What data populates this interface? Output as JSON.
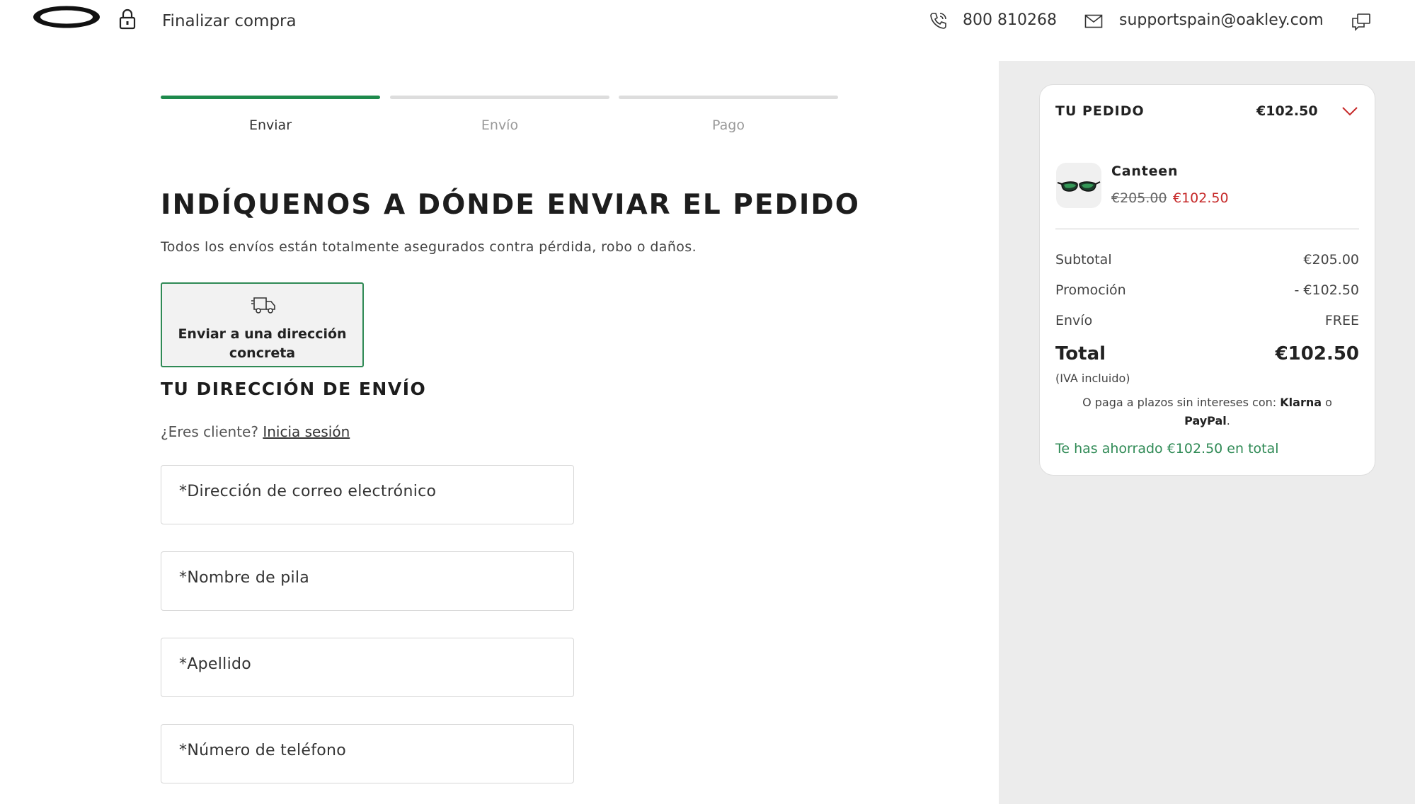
{
  "header": {
    "checkout_title": "Finalizar compra",
    "phone": "800 810268",
    "email": "supportspain@oakley.com"
  },
  "steps": [
    {
      "label": "Enviar",
      "active": true
    },
    {
      "label": "Envío",
      "active": false
    },
    {
      "label": "Pago",
      "active": false
    }
  ],
  "main": {
    "title": "INDÍQUENOS A DÓNDE ENVIAR EL PEDIDO",
    "subtitle": "Todos los envíos están totalmente asegurados contra pérdida, robo o daños.",
    "ship_option_label": "Enviar a una dirección concreta",
    "address_heading": "TU DIRECCIÓN DE ENVÍO",
    "login_prompt": "¿Eres cliente?",
    "login_link": "Inicia sesión",
    "fields": [
      {
        "label": "Dirección de correo electrónico"
      },
      {
        "label": "Nombre de pila"
      },
      {
        "label": "Apellido"
      },
      {
        "label": "Número de teléfono"
      }
    ]
  },
  "order": {
    "label": "TU PEDIDO",
    "total_header": "€102.50",
    "product": {
      "name": "Canteen",
      "old_price": "€205.00",
      "new_price": "€102.50"
    },
    "rows": [
      {
        "label": "Subtotal",
        "value": "€205.00"
      },
      {
        "label": "Promoción",
        "value": "- €102.50"
      },
      {
        "label": "Envío",
        "value": "FREE"
      }
    ],
    "total_label": "Total",
    "total_value": "€102.50",
    "iva": "(IVA incluido)",
    "installments_prefix": "O paga a plazos sin intereses con:",
    "klarna": "Klarna",
    "or": "o",
    "paypal": "PayPal",
    "saved": "Te has ahorrado €102.50 en total"
  },
  "colors": {
    "accent_green": "#1e8a4c",
    "sale_red": "#c62828",
    "sidebar_bg": "#ececec"
  },
  "icons": [
    "oakley-logo",
    "lock-icon",
    "phone-icon",
    "mail-icon",
    "chat-icon",
    "truck-icon",
    "chevron-down-icon"
  ]
}
